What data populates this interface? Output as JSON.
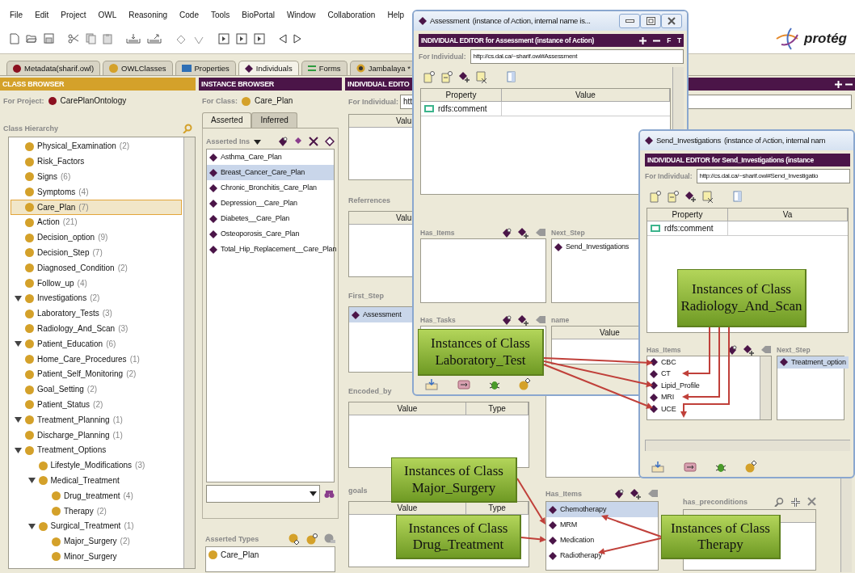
{
  "menu": [
    "File",
    "Edit",
    "Project",
    "OWL",
    "Reasoning",
    "Code",
    "Tools",
    "BioPortal",
    "Window",
    "Collaboration",
    "Help"
  ],
  "logo": {
    "text": "protég"
  },
  "tabs": [
    {
      "label": "Metadata(sharif.owl)",
      "selected": false
    },
    {
      "label": "OWLClasses",
      "selected": false
    },
    {
      "label": "Properties",
      "selected": false
    },
    {
      "label": "Individuals",
      "selected": true
    },
    {
      "label": "Forms",
      "selected": false
    },
    {
      "label": "Jambalaya *",
      "selected": false
    }
  ],
  "class_browser": {
    "title": "CLASS BROWSER",
    "project_label": "For Project:",
    "project": "CarePlanOntology",
    "hierarchy_label": "Class Hierarchy",
    "tree": [
      {
        "children": [
          {
            "label": "Physical_Examination",
            "count": "(2)",
            "selected": false
          },
          {
            "label": "Risk_Factors",
            "selected": false
          },
          {
            "label": "Signs",
            "count": "(6)",
            "selected": false
          },
          {
            "label": "Symptoms",
            "count": "(4)",
            "selected": false
          }
        ]
      },
      {
        "label": "Care_Plan",
        "count": "(7)",
        "selected": true
      },
      {
        "label": "Action",
        "count": "(21)",
        "selected": false
      },
      {
        "label": "Decision_option",
        "count": "(9)",
        "selected": false
      },
      {
        "label": "Decision_Step",
        "count": "(7)",
        "selected": false
      },
      {
        "label": "Diagnosed_Condition",
        "count": "(2)",
        "selected": false
      },
      {
        "label": "Follow_up",
        "count": "(4)",
        "selected": false
      },
      {
        "label": "Investigations",
        "count": "(2)",
        "selected": false,
        "expanded": true,
        "children": [
          {
            "label": "Laboratory_Tests",
            "count": "(3)",
            "selected": false
          },
          {
            "label": "Radiology_And_Scan",
            "count": "(3)",
            "selected": false
          }
        ]
      },
      {
        "label": "Patient_Education",
        "count": "(6)",
        "selected": false,
        "expanded": true,
        "children": [
          {
            "label": "Home_Care_Procedures",
            "count": "(1)",
            "selected": false
          },
          {
            "label": "Patient_Self_Monitoring",
            "count": "(2)",
            "selected": false
          },
          {
            "label": "Goal_Setting",
            "count": "(2)",
            "selected": false
          }
        ]
      },
      {
        "label": "Patient_Status",
        "count": "(2)",
        "selected": false
      },
      {
        "label": "Treatment_Planning",
        "count": "(1)",
        "selected": false,
        "expanded": true,
        "children": [
          {
            "label": "Discharge_Planning",
            "count": "(1)",
            "selected": false
          },
          {
            "label": "Treatment_Options",
            "selected": false,
            "expanded": true,
            "children": [
              {
                "label": "Lifestyle_Modifications",
                "count": "(3)",
                "selected": false
              },
              {
                "label": "Medical_Treatment",
                "selected": false,
                "expanded": true,
                "children": [
                  {
                    "label": "Drug_treatment",
                    "count": "(4)",
                    "selected": false
                  },
                  {
                    "label": "Therapy",
                    "count": "(2)",
                    "selected": false
                  }
                ]
              },
              {
                "label": "Surgical_Treatment",
                "count": "(1)",
                "selected": false,
                "expanded": true,
                "children": [
                  {
                    "label": "Major_Surgery",
                    "count": "(2)",
                    "selected": false
                  },
                  {
                    "label": "Minor_Surgery",
                    "selected": false
                  }
                ]
              }
            ]
          }
        ]
      }
    ]
  },
  "instance_browser": {
    "title": "INSTANCE BROWSER",
    "class_label": "For Class:",
    "class": "Care_Plan",
    "tabs": [
      {
        "label": "Asserted",
        "selected": true
      },
      {
        "label": "Inferred",
        "selected": false
      }
    ],
    "list_label": "Asserted Ins",
    "instances": [
      {
        "label": "Asthma_Care_Plan",
        "selected": false
      },
      {
        "label": "Breast_Cancer_Care_Plan",
        "selected": true
      },
      {
        "label": "Chronic_Bronchitis_Care_Plan",
        "selected": false
      },
      {
        "label": "Depression__Care_Plan",
        "selected": false
      },
      {
        "label": "Diabetes__Care_Plan",
        "selected": false
      },
      {
        "label": "Osteoporosis_Care_Plan",
        "selected": false
      },
      {
        "label": "Total_Hip_Replacement__Care_Plan",
        "selected": false
      }
    ],
    "types_label": "Asserted Types",
    "types": [
      "Care_Plan"
    ]
  },
  "individual_editor": {
    "title": "INDIVIDUAL EDITO",
    "individual_label": "For Individual:",
    "individual": "htt",
    "sections": [
      {
        "kind": "table",
        "columns": [
          "Valu"
        ]
      },
      {
        "kind": "table",
        "label": "Referrences",
        "columns": [
          "Valu"
        ]
      },
      {
        "kind": "list",
        "label": "First_Step",
        "items": [
          {
            "label": "Assessment",
            "selected": true
          }
        ]
      },
      {
        "kind": "table",
        "label": "Encoded_by",
        "columns": [
          "Value",
          "Type"
        ]
      },
      {
        "kind": "table",
        "label": "goals",
        "columns": [
          "Value",
          "Type"
        ]
      }
    ],
    "has_items": {
      "label": "Has_Items",
      "items": [
        {
          "label": "Chemotherapy",
          "selected": true
        },
        {
          "label": "MRM",
          "selected": false
        },
        {
          "label": "Medication",
          "selected": false
        },
        {
          "label": "Radiotherapy",
          "selected": false
        }
      ]
    },
    "preconditions": {
      "label": "has_preconditions"
    }
  },
  "windows": [
    {
      "title": "Assessment",
      "subtitle": "(instance of Action, internal name is...",
      "title_buttons": true,
      "header": "INDIVIDUAL EDITOR for Assessment   (instance of Action)",
      "header_letters": [
        "F",
        "T"
      ],
      "individual_label": "For Individual:",
      "individual": "http://cs.dal.ca/~sharif.owl#Assessment",
      "columns": [
        "Property",
        "Value"
      ],
      "property": "rdfs:comment",
      "sections": [
        {
          "kind": "list",
          "label": "Has_Items"
        },
        {
          "kind": "list",
          "label": "Next_Step",
          "items": [
            {
              "label": "Send_Investigations",
              "selected": false
            }
          ]
        },
        {
          "kind": "list",
          "label": "Has_Tasks"
        },
        {
          "kind": "table",
          "label": "name",
          "columns": [
            "Value"
          ]
        }
      ]
    },
    {
      "title": "Send_Investigations",
      "subtitle": "(instance of Action, internal nam",
      "title_buttons": false,
      "header": "INDIVIDUAL EDITOR for Send_Investigations  (instance",
      "individual_label": "For Individual:",
      "individual": "http://cs.dal.ca/~sharif.owl#Send_Investigatio",
      "columns": [
        "Property",
        "Va"
      ],
      "property": "rdfs:comment",
      "sections": [
        {
          "kind": "list",
          "label": "Has_Items",
          "items": [
            {
              "label": "CBC",
              "selected": false
            },
            {
              "label": "CT",
              "selected": false
            },
            {
              "label": "Lipid_Profile",
              "selected": false
            },
            {
              "label": "MRI",
              "selected": false
            },
            {
              "label": "UCE",
              "selected": false
            }
          ]
        },
        {
          "kind": "list",
          "label": "Next_Step",
          "items": [
            {
              "label": "Treatment_option",
              "selected": true
            }
          ]
        }
      ]
    }
  ],
  "callouts": [
    {
      "lines": [
        "Instances of Class",
        "Radiology_And_Scan"
      ]
    },
    {
      "lines": [
        "Instances of Class",
        "Laboratory_Test"
      ]
    },
    {
      "lines": [
        "Instances of Class",
        "Major_Surgery"
      ]
    },
    {
      "lines": [
        "Instances of Class",
        "Drug_Treatment"
      ]
    },
    {
      "lines": [
        "Instances of Class",
        "Therapy"
      ]
    }
  ]
}
